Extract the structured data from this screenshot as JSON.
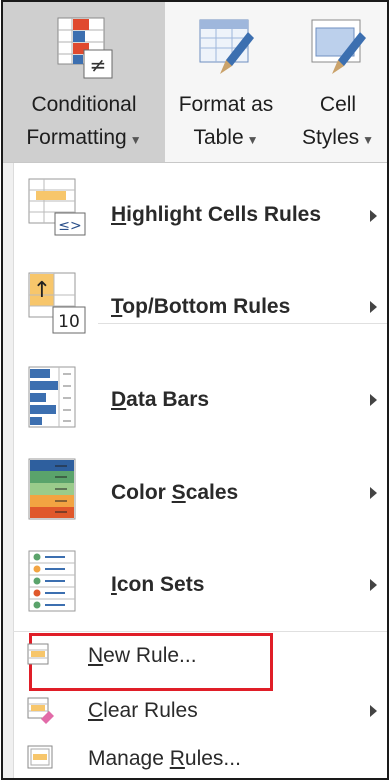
{
  "ribbon": {
    "conditional": {
      "line1": "Conditional",
      "line2": "Formatting"
    },
    "format_table": {
      "line1": "Format as",
      "line2": "Table"
    },
    "cell_styles": {
      "line1": "Cell",
      "line2": "Styles"
    }
  },
  "menu": {
    "items": [
      {
        "pre": "",
        "key": "H",
        "post": "ighlight Cells Rules",
        "icon": "highlight-cells-icon",
        "submenu": true
      },
      {
        "pre": "",
        "key": "T",
        "post": "op/Bottom Rules",
        "icon": "top-bottom-icon",
        "submenu": true
      },
      {
        "pre": "",
        "key": "D",
        "post": "ata Bars",
        "icon": "data-bars-icon",
        "submenu": true
      },
      {
        "pre": "Color ",
        "key": "S",
        "post": "cales",
        "icon": "color-scales-icon",
        "submenu": true
      },
      {
        "pre": "",
        "key": "I",
        "post": "con Sets",
        "icon": "icon-sets-icon",
        "submenu": true
      }
    ],
    "actions": [
      {
        "pre": "",
        "key": "N",
        "post": "ew Rule...",
        "icon": "new-rule-icon",
        "submenu": false
      },
      {
        "pre": "",
        "key": "C",
        "post": "lear Rules",
        "icon": "clear-rules-icon",
        "submenu": true
      },
      {
        "pre": "Manage ",
        "key": "R",
        "post": "ules...",
        "icon": "manage-rules-icon",
        "submenu": false
      }
    ],
    "icon_texts": {
      "highlight": "≤>",
      "topbottom_arrow": "↑",
      "topbottom_num": "10",
      "neq": "≠"
    }
  },
  "colors": {
    "highlight_border": "#e01e28",
    "active_button": "#cfcfcf",
    "accent_blue": "#3c6fb0"
  }
}
